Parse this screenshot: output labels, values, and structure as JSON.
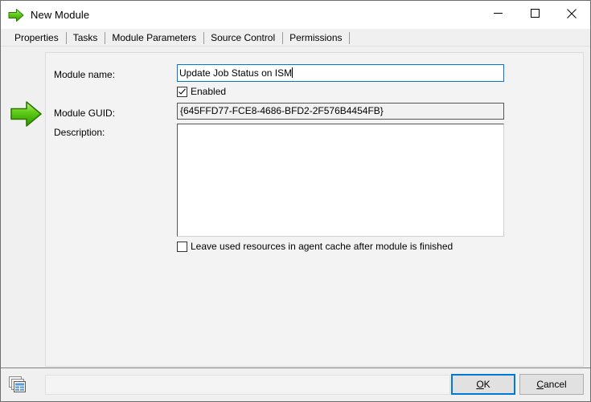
{
  "window": {
    "title": "New Module",
    "title_icon": "green-arrow-icon",
    "minimize_label": "Minimize",
    "maximize_label": "Maximize",
    "close_label": "Close"
  },
  "tabs": [
    {
      "label": "Properties",
      "active": true
    },
    {
      "label": "Tasks",
      "active": false
    },
    {
      "label": "Module Parameters",
      "active": false
    },
    {
      "label": "Source Control",
      "active": false
    },
    {
      "label": "Permissions",
      "active": false
    }
  ],
  "properties": {
    "panel_icon": "green-arrow-icon",
    "module_name_label": "Module name:",
    "module_name_value": "Update Job Status on ISM",
    "module_name_placeholder": "",
    "enabled_label": "Enabled",
    "enabled_checked": true,
    "module_guid_label": "Module GUID:",
    "module_guid_value": "{645FFD77-FCE8-4686-BFD2-2F576B4454FB}",
    "description_label": "Description:",
    "description_value": "",
    "description_placeholder": "",
    "leave_cache_label": "Leave used resources in agent cache after module is finished",
    "leave_cache_checked": false
  },
  "footer": {
    "icon": "cascading-windows-icon",
    "status_value": "",
    "ok_mnemonic": "O",
    "ok_rest": "K",
    "cancel_mnemonic": "C",
    "cancel_rest": "ancel"
  },
  "colors": {
    "accent": "#0078d7",
    "arrow_green": "#4cb400",
    "window_bg": "#f0f0f0",
    "panel_bg": "#f3f3f3",
    "field_bg": "#ffffff"
  }
}
